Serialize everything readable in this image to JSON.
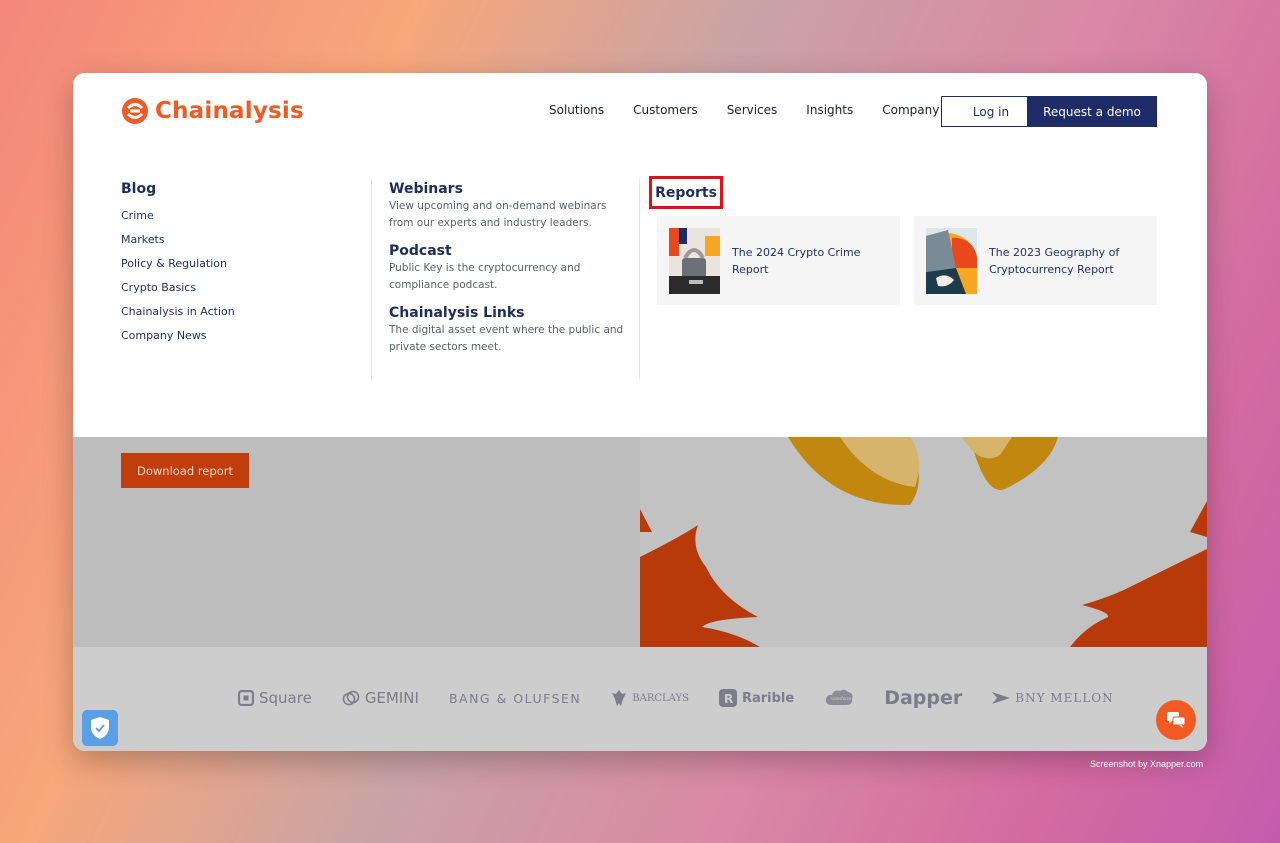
{
  "header": {
    "brand": "Chainalysis",
    "nav": [
      "Solutions",
      "Customers",
      "Services",
      "Insights",
      "Company"
    ],
    "login_label": "Log in",
    "demo_label": "Request a demo"
  },
  "menu": {
    "blog": {
      "heading": "Blog",
      "links": [
        "Crime",
        "Markets",
        "Policy & Regulation",
        "Crypto Basics",
        "Chainalysis in Action",
        "Company News"
      ]
    },
    "resources": [
      {
        "title": "Webinars",
        "desc": "View upcoming and on-demand webinars from our experts and industry leaders."
      },
      {
        "title": "Podcast",
        "desc": "Public Key is the cryptocurrency and compliance podcast."
      },
      {
        "title": "Chainalysis Links",
        "desc": "The digital asset event where the public and private sectors meet."
      }
    ],
    "reports": {
      "heading": "Reports",
      "cards": [
        {
          "title": "The 2024 Crypto Crime Report"
        },
        {
          "title": "The 2023 Geography of Cryptocurrency Report"
        }
      ]
    }
  },
  "hero": {
    "download_label": "Download report"
  },
  "customer_logos": [
    "Square",
    "GEMINI",
    "BANG & OLUFSEN",
    "BARCLAYS",
    "Rarible",
    "salesforce",
    "Dapper",
    "BNY MELLON"
  ],
  "credit": "Screenshot by Xnapper.com",
  "colors": {
    "brand_orange": "#f15a22",
    "navy": "#1e2d68",
    "highlight_red": "#e30e1a"
  }
}
